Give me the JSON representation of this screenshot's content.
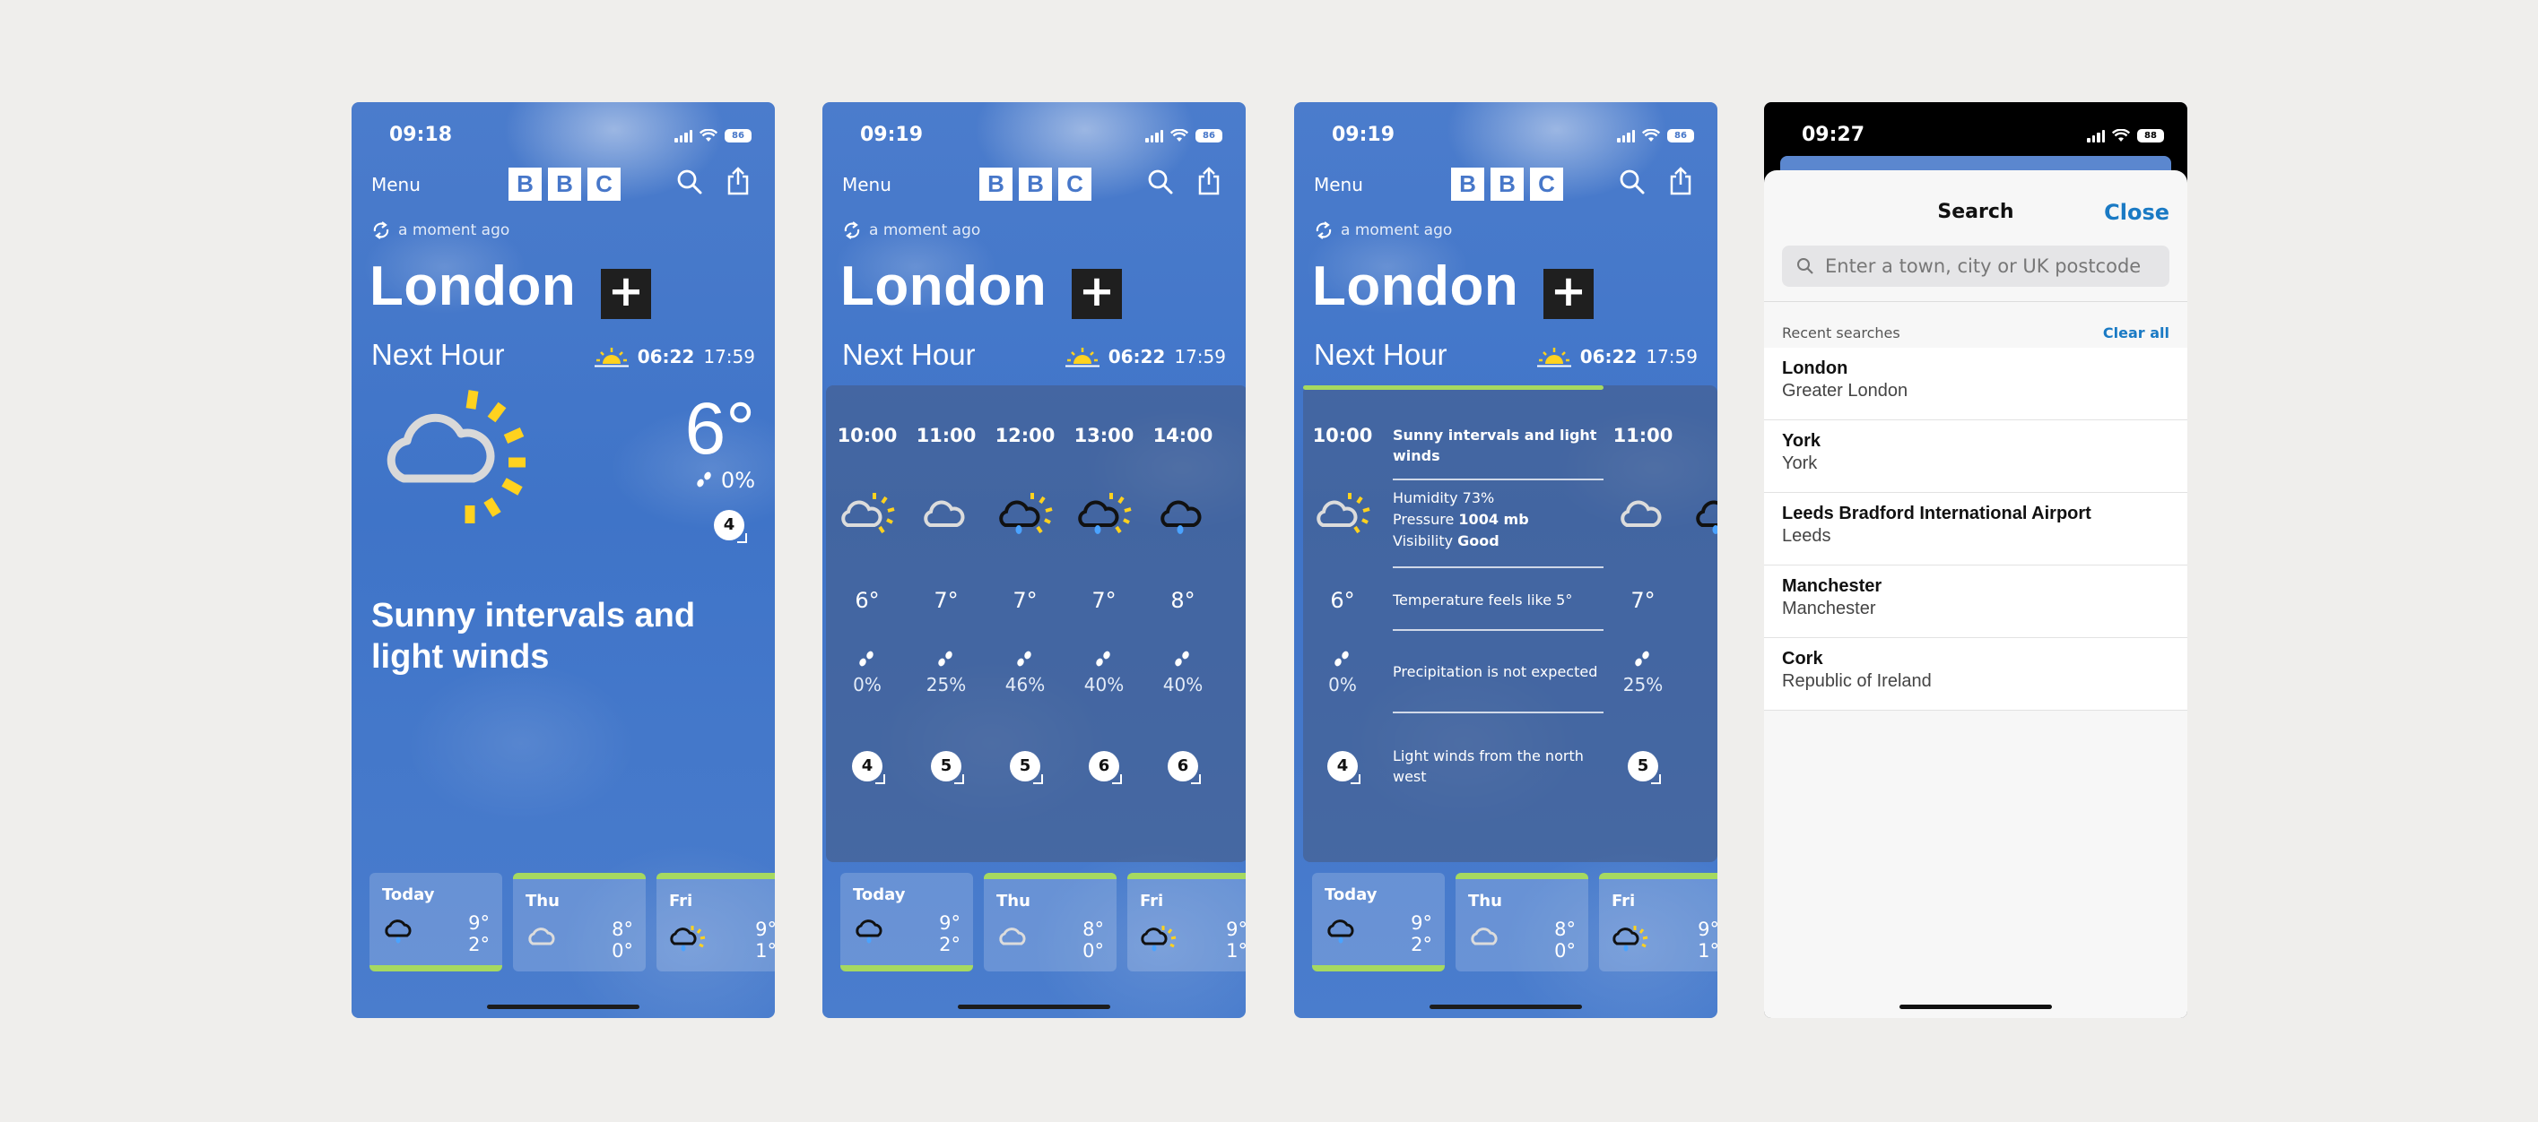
{
  "status": {
    "time1": "09:18",
    "time2": "09:19",
    "time3": "09:19",
    "time4": "09:27",
    "battery": "86",
    "battery4": "88"
  },
  "header": {
    "menu_label": "Menu",
    "logo": [
      "B",
      "B",
      "C"
    ]
  },
  "location": {
    "updated": "a moment ago",
    "city": "London",
    "add_label": "+",
    "next_hour": "Next Hour",
    "sunrise": "06:22",
    "sunset": "17:59"
  },
  "current": {
    "temp": "6°",
    "precip": "0%",
    "wind": "4",
    "summary": "Sunny intervals and light winds"
  },
  "hourly": [
    {
      "time": "10:00",
      "icon": "sun-cloud-icon",
      "temp": "6°",
      "precip": "0%",
      "wind": "4"
    },
    {
      "time": "11:00",
      "icon": "cloud-icon",
      "temp": "7°",
      "precip": "25%",
      "wind": "5"
    },
    {
      "time": "12:00",
      "icon": "sun-cloud-rain-icon",
      "temp": "7°",
      "precip": "46%",
      "wind": "5"
    },
    {
      "time": "13:00",
      "icon": "sun-cloud-rain-icon",
      "temp": "7°",
      "precip": "40%",
      "wind": "6"
    },
    {
      "time": "14:00",
      "icon": "cloud-rain-icon",
      "temp": "8°",
      "precip": "40%",
      "wind": "6"
    }
  ],
  "hour_detail": {
    "title": "Sunny intervals and light winds",
    "humidity_label": "Humidity",
    "humidity": "73%",
    "pressure_label": "Pressure",
    "pressure": "1004 mb",
    "visibility_label": "Visibility",
    "visibility": "Good",
    "feels_like": "Temperature feels like 5°",
    "precip_text": "Precipitation is not expected",
    "wind_text": "Light winds from the north west"
  },
  "days": [
    {
      "name": "Today",
      "high": "9°",
      "low": "2°",
      "icon": "cloud-rain-icon"
    },
    {
      "name": "Thu",
      "high": "8°",
      "low": "0°",
      "icon": "cloud-icon"
    },
    {
      "name": "Fri",
      "high": "9°",
      "low": "1°",
      "icon": "sun-cloud-rain-icon"
    }
  ],
  "search": {
    "title": "Search",
    "close_label": "Close",
    "placeholder": "Enter a town, city or UK postcode",
    "recent_label": "Recent searches",
    "clear_label": "Clear all",
    "recent": [
      {
        "name": "London",
        "sub": "Greater London"
      },
      {
        "name": "York",
        "sub": "York"
      },
      {
        "name": "Leeds Bradford International Airport",
        "sub": "Leeds"
      },
      {
        "name": "Manchester",
        "sub": "Manchester"
      },
      {
        "name": "Cork",
        "sub": "Republic of Ireland"
      }
    ]
  }
}
